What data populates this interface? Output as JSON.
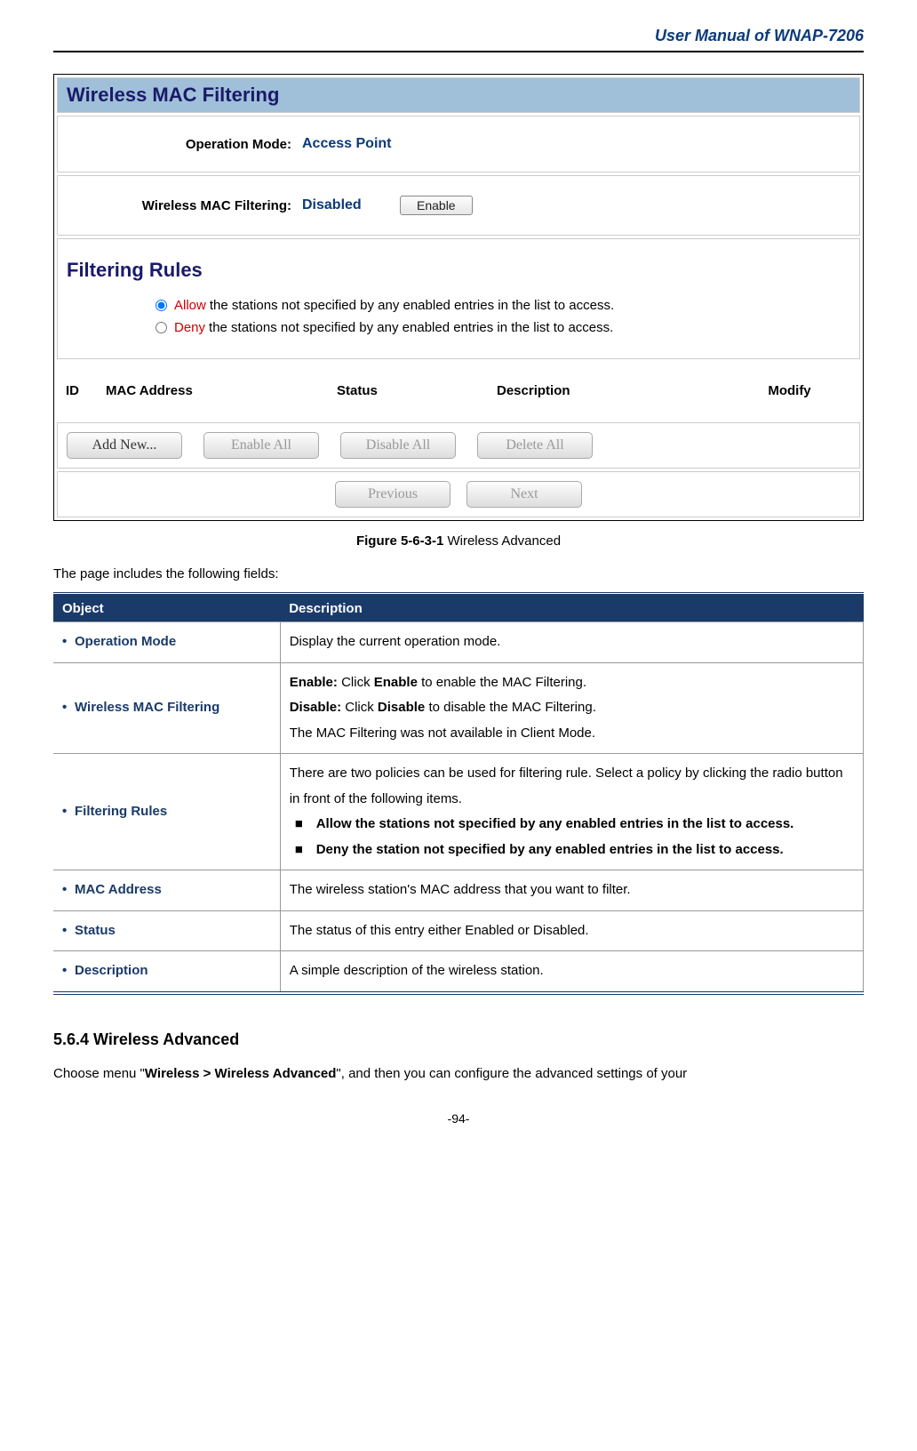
{
  "header": {
    "title": "User Manual of WNAP-7206"
  },
  "screenshot": {
    "title_bar": "Wireless MAC Filtering",
    "operation_mode": {
      "label": "Operation Mode:",
      "value": "Access Point"
    },
    "mac_filtering": {
      "label": "Wireless MAC Filtering:",
      "value": "Disabled",
      "enable_button": "Enable"
    },
    "filtering_rules": {
      "heading": "Filtering Rules",
      "allow_word": "Allow",
      "allow_rest": " the stations not specified by any enabled entries in the list to access.",
      "deny_word": "Deny",
      "deny_rest": " the stations not specified by any enabled entries in the list to access."
    },
    "table_head": {
      "id": "ID",
      "mac": "MAC Address",
      "status": "Status",
      "description": "Description",
      "modify": "Modify"
    },
    "buttons": {
      "add_new": "Add New...",
      "enable_all": "Enable All",
      "disable_all": "Disable All",
      "delete_all": "Delete All"
    },
    "nav": {
      "previous": "Previous",
      "next": "Next"
    }
  },
  "caption": {
    "bold": "Figure 5-6-3-1",
    "rest": " Wireless Advanced"
  },
  "intro": "The page includes the following fields:",
  "fields_table": {
    "head_object": "Object",
    "head_description": "Description",
    "rows": {
      "r0": {
        "object": "Operation Mode",
        "desc_plain": "Display the current operation mode."
      },
      "r1": {
        "object": "Wireless MAC Filtering",
        "enable_label": "Enable:",
        "enable_rest": " Click ",
        "enable_bold": "Enable",
        "enable_tail": " to enable the MAC Filtering.",
        "disable_label": "Disable:",
        "disable_rest": " Click ",
        "disable_bold": "Disable",
        "disable_tail": " to disable the MAC Filtering.",
        "note": "The MAC Filtering was not available in Client Mode."
      },
      "r2": {
        "object": "Filtering Rules",
        "lead": "There are two policies can be used for filtering rule. Select a policy by clicking the radio button in front of the following items.",
        "b1": "Allow the stations not specified by any enabled entries in the list to access.",
        "b2": "Deny the station not specified by any enabled entries in the list to access."
      },
      "r3": {
        "object": "MAC Address",
        "desc_plain": "The wireless station's MAC address that you want to filter."
      },
      "r4": {
        "object": "Status",
        "desc_plain": "The status of this entry either Enabled or Disabled."
      },
      "r5": {
        "object": "Description",
        "desc_plain": "A simple description of the wireless station."
      }
    }
  },
  "section564": {
    "heading": "5.6.4   Wireless Advanced",
    "p_pre": "Choose menu \"",
    "p_bold": "Wireless > Wireless Advanced",
    "p_post": "\", and then you can configure the advanced settings of your"
  },
  "footer": "-94-"
}
